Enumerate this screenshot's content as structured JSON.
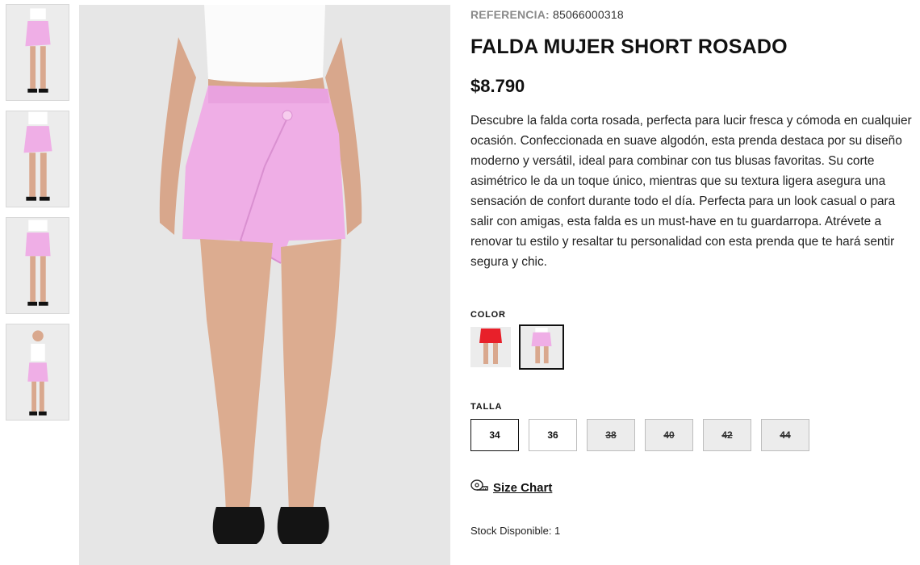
{
  "product": {
    "reference_label": "REFERENCIA:",
    "reference_value": "85066000318",
    "title": "FALDA MUJER SHORT ROSADO",
    "price": "$8.790",
    "description": "Descubre la falda corta rosada, perfecta para lucir fresca y cómoda en cualquier ocasión. Confeccionada en suave algodón, esta prenda destaca por su diseño moderno y versátil, ideal para combinar con tus blusas favoritas. Su corte asimétrico le da un toque único, mientras que su textura ligera asegura una sensación de confort durante todo el día. Perfecta para un look casual o para salir con amigas, esta falda es un must-have en tu guardarropa. Atrévete a renovar tu estilo y resaltar tu personalidad con esta prenda que te hará sentir segura y chic."
  },
  "gallery": {
    "thumbnails": [
      "front-view",
      "front-closeup",
      "back-view",
      "full-body"
    ],
    "selected_thumbnail": 0
  },
  "color": {
    "label": "COLOR",
    "options": [
      {
        "name": "rojo",
        "hex": "#e8202a",
        "selected": false
      },
      {
        "name": "rosado",
        "hex": "#f0b0e6",
        "selected": true
      }
    ]
  },
  "size": {
    "label": "TALLA",
    "options": [
      {
        "label": "34",
        "available": true,
        "selected": true
      },
      {
        "label": "36",
        "available": true,
        "selected": false
      },
      {
        "label": "38",
        "available": false,
        "selected": false
      },
      {
        "label": "40",
        "available": false,
        "selected": false
      },
      {
        "label": "42",
        "available": false,
        "selected": false
      },
      {
        "label": "44",
        "available": false,
        "selected": false
      }
    ]
  },
  "size_chart": {
    "label": "Size Chart",
    "icon": "measuring-tape-icon"
  },
  "stock": {
    "text": "Stock Disponible: 1"
  },
  "colors": {
    "skirt_pink": "#efaee6",
    "background": "#e6e6e6",
    "text": "#111111"
  }
}
